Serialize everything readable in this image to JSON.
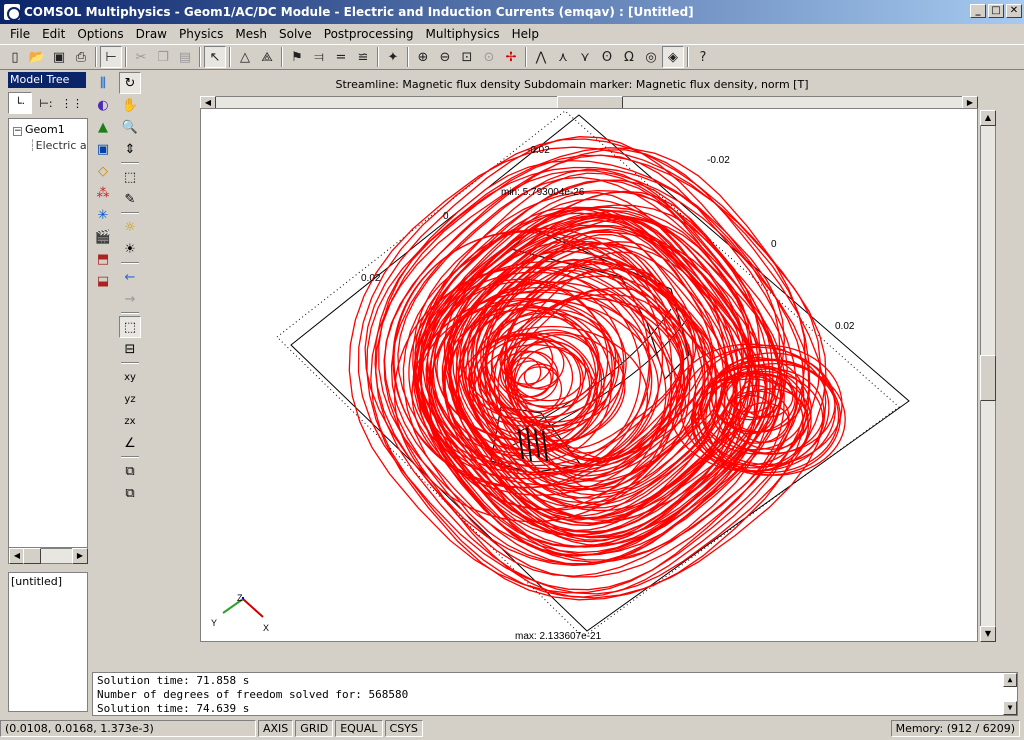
{
  "window": {
    "title": "COMSOL Multiphysics - Geom1/AC/DC Module - Electric and Induction Currents (emqav) : [Untitled]",
    "controls": [
      "_",
      "□",
      "✕"
    ]
  },
  "menu": [
    "File",
    "Edit",
    "Options",
    "Draw",
    "Physics",
    "Mesh",
    "Solve",
    "Postprocessing",
    "Multiphysics",
    "Help"
  ],
  "toolbar_icons": [
    "new-icon",
    "open-icon",
    "save-icon",
    "print-icon",
    "sep",
    "tree-icon",
    "sep",
    "cut-icon",
    "copy-icon",
    "paste-icon",
    "sep",
    "select-icon",
    "sep",
    "draw-mode-icon",
    "mesh-mode-icon",
    "sep",
    "subdomain-icon",
    "boundary-icon",
    "equal-icon",
    "edge-icon",
    "sep",
    "solve-icon",
    "sep",
    "zoom-in-icon",
    "zoom-out-icon",
    "zoom-window-icon",
    "zoom-extents-icon",
    "sep",
    "selection-icon",
    "sep",
    "init-mesh-icon",
    "refine-mesh-icon",
    "refine-selection-icon",
    "omega-icon",
    "circle-icon",
    "plot-icon",
    "sep",
    "help-icon"
  ],
  "model_tree": {
    "header": "Model Tree",
    "root": "Geom1",
    "child": "Electric a",
    "notes": "[untitled]"
  },
  "plot": {
    "title": "Streamline: Magnetic flux density   Subdomain marker: Magnetic flux density, norm [T]",
    "min_label": "min: 5.793004e-26",
    "max_label": "max: 2.133607e-21",
    "axis_labels": [
      "-0.02",
      "-0.02",
      "0",
      "0",
      "0.02",
      "0.02"
    ],
    "triad": {
      "y": "Y",
      "z": "Z",
      "x": "X"
    },
    "streamline_color": "#ff0000"
  },
  "console": {
    "lines": [
      "Solution time: 71.858 s",
      "Number of degrees of freedom solved for: 568580",
      "Solution time: 74.639 s"
    ]
  },
  "status": {
    "coords": "(0.0108, 0.0168, 1.373e-3)",
    "toggles": [
      "AXIS",
      "GRID",
      "EQUAL",
      "CSYS"
    ],
    "memory": "Memory: (912 / 6209)"
  }
}
